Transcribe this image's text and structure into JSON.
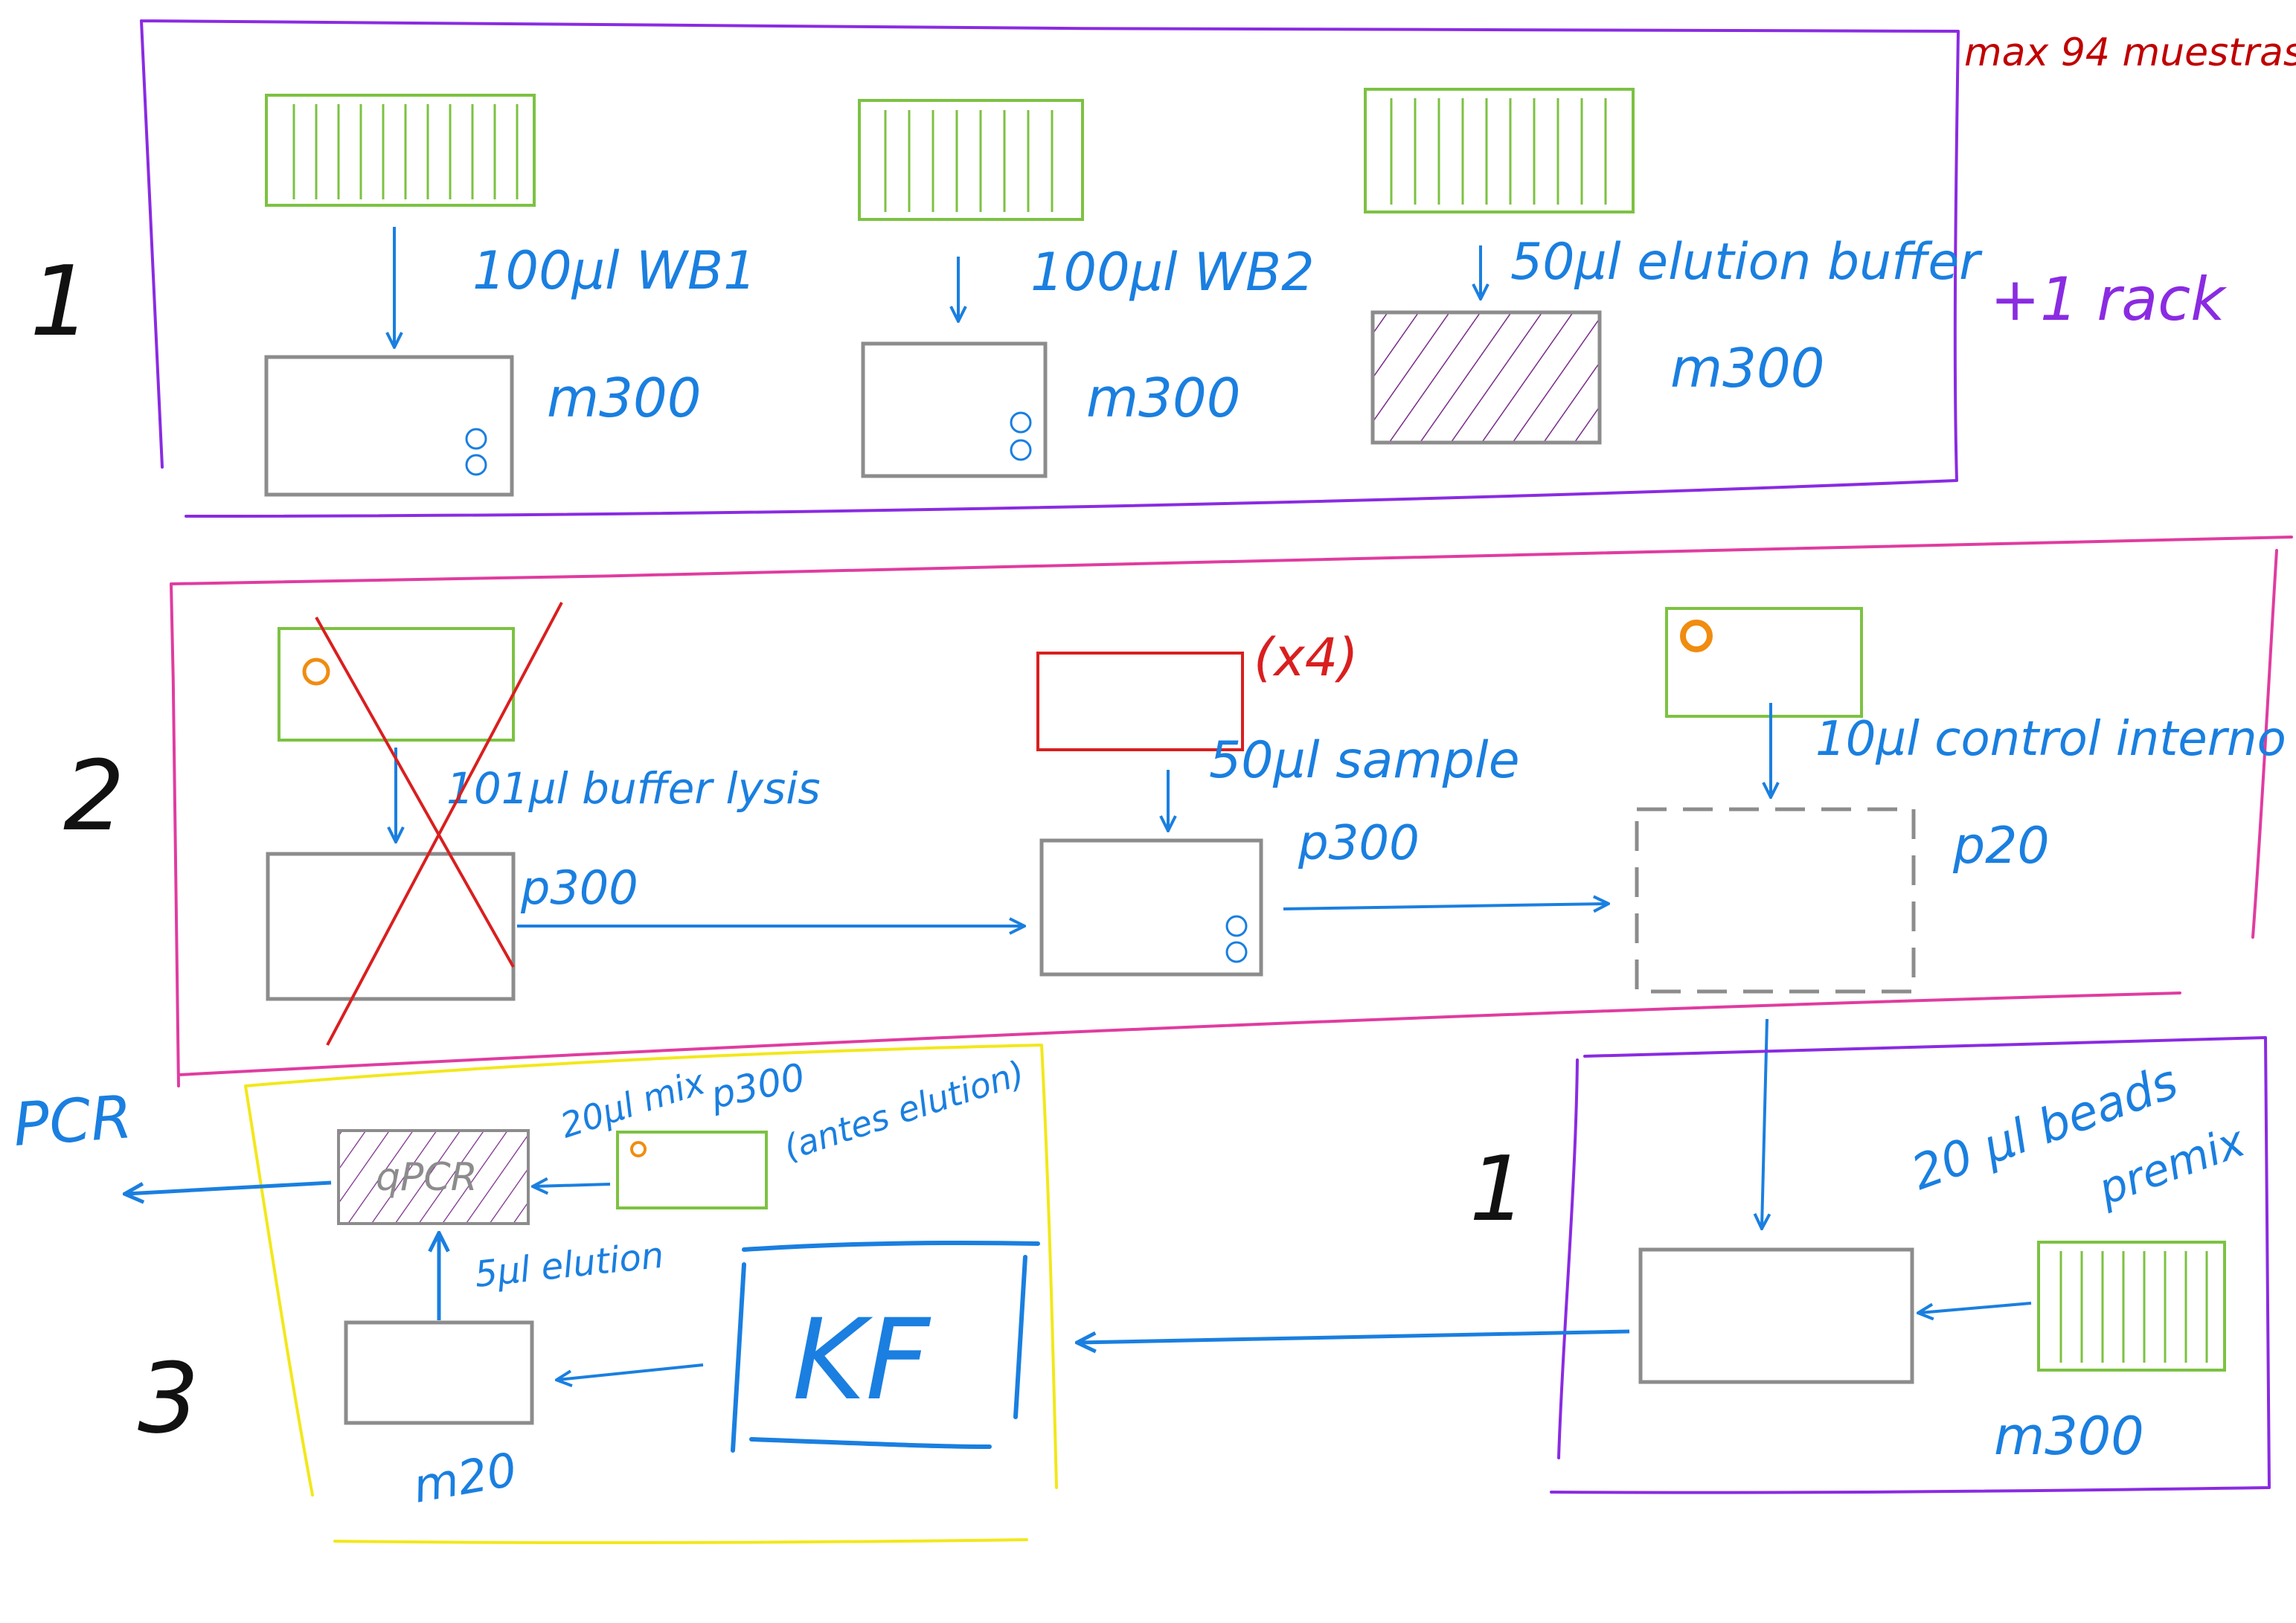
{
  "colors": {
    "purple": "#8a2be2",
    "magenta": "#e03ca0",
    "yellow": "#f2e81a",
    "blue": "#1a7fe0",
    "green": "#7cc242",
    "red": "#d91f1f",
    "darkred": "#c00000",
    "gray": "#8c8c8c",
    "orange": "#f08c10",
    "black": "#111111",
    "hatch": "#7a2a8a"
  },
  "header": {
    "max_samples": "max 94 muestras"
  },
  "section1": {
    "number": "1",
    "extra_rack": "+1 rack",
    "steps": [
      {
        "volume_label": "100µl WB1",
        "pipette": "m300"
      },
      {
        "volume_label": "100µl WB2",
        "pipette": "m300"
      },
      {
        "volume_label": "50µl elution buffer",
        "pipette": "m300"
      }
    ]
  },
  "section2": {
    "number": "2",
    "lysis_label": "101µl buffer lysis",
    "lysis_pipette": "p300",
    "sample_multiplier": "(x4)",
    "sample_label": "50µl sample",
    "sample_pipette": "p300",
    "control_label": "10µl control interno",
    "control_pipette": "p20"
  },
  "section1b": {
    "number": "1",
    "beads_label": "20 µl beads",
    "beads_label_2": "premix",
    "pipette": "m300"
  },
  "section3": {
    "number": "3",
    "pcr_out_label": "PCR",
    "qpcr_label": "qPCR",
    "mix_label": "20µl mix",
    "mix_pipette": "p300",
    "mix_note": "(antes elution)",
    "elution_label": "5µl elution",
    "plate_pipette": "m20",
    "kf_label": "KF"
  }
}
